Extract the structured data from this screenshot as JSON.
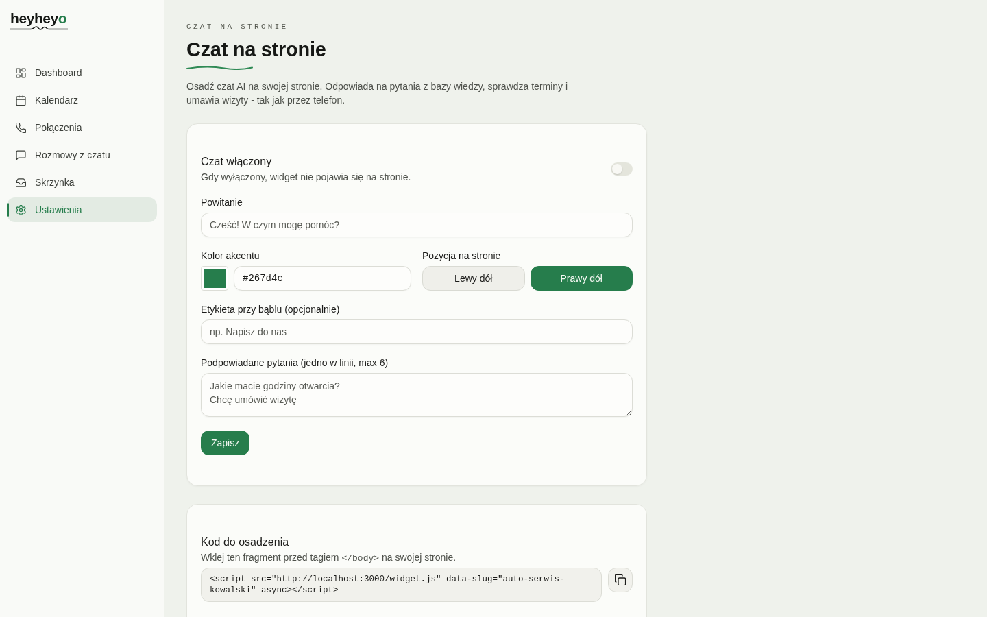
{
  "sidebar": {
    "logo": {
      "text": "heyhey",
      "accent_text": "o"
    },
    "items": [
      {
        "label": "Dashboard",
        "selected": false
      },
      {
        "label": "Kalendarz",
        "selected": false
      },
      {
        "label": "Połączenia",
        "selected": false
      },
      {
        "label": "Rozmowy z czatu",
        "selected": false
      },
      {
        "label": "Skrzynka",
        "selected": false
      },
      {
        "label": "Ustawienia",
        "selected": true
      }
    ]
  },
  "page": {
    "eyebrow": "CZAT NA STRONIE",
    "title": "Czat na stronie",
    "description": "Osadź czat AI na swojej stronie. Odpowiada na pytania z bazy wiedzy, sprawdza terminy i umawia wizyty - tak jak przez telefon."
  },
  "settings_card": {
    "chat_toggle": {
      "title": "Czat włączony",
      "description": "Gdy wyłączony, widget nie pojawia się na stronie.",
      "on": false
    },
    "greeting": {
      "label": "Powitanie",
      "placeholder": "Cześć! W czym mogę pomóc?"
    },
    "accent_color": {
      "label": "Kolor akcentu",
      "value": "#267d4c"
    },
    "position": {
      "label": "Pozycja na stronie",
      "options": [
        {
          "label": "Lewy dół",
          "selected": false
        },
        {
          "label": "Prawy dół",
          "selected": true
        }
      ]
    },
    "bubble_label": {
      "label": "Etykieta przy bąblu (opcjonalnie)",
      "placeholder": "np. Napisz do nas"
    },
    "suggested_questions": {
      "label": "Podpowiadane pytania (jedno w linii, max 6)",
      "placeholder": "Jakie macie godziny otwarcia?\nChcę umówić wizytę"
    },
    "save_button": "Zapisz"
  },
  "embed_card": {
    "title": "Kod do osadzenia",
    "description": {
      "before": "Wklej ten fragment przed tagiem ",
      "code": "</body>",
      "after": " na swojej stronie."
    },
    "code": "<script src=\"http://localhost:3000/widget.js\" data-slug=\"auto-serwis-kowalski\" async></script>"
  }
}
